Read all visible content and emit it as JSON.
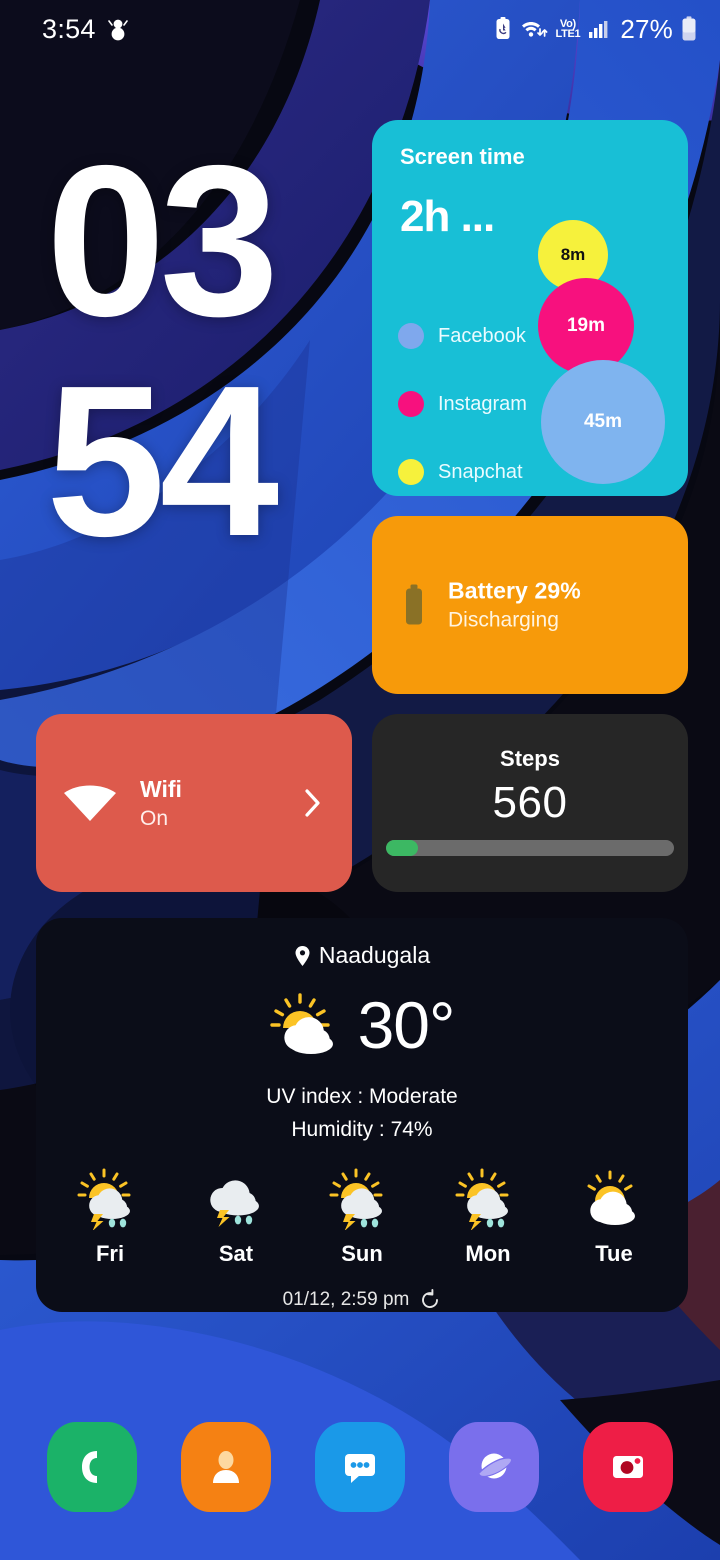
{
  "statusbar": {
    "time": "3:54",
    "notification_icon": "snowman-icon",
    "battery_saver_icon": "battery-saver-icon",
    "wifi_icon": "wifi-data-icon",
    "volte_top": "Vo)",
    "volte_bottom": "LTE1",
    "signal_icon": "signal-bars-icon",
    "battery_percent": "27%",
    "battery_icon": "battery-icon"
  },
  "clock": {
    "hours": "03",
    "minutes": "54"
  },
  "screen_time": {
    "title": "Screen time",
    "total": "2h ...",
    "legend": [
      {
        "label": "Facebook",
        "color": "#7FA8ED"
      },
      {
        "label": "Instagram",
        "color": "#F7117E"
      },
      {
        "label": "Snapchat",
        "color": "#F6F13C"
      }
    ],
    "bubbles": [
      {
        "label": "8m",
        "color": "#F6F13C",
        "text_color": "#111111"
      },
      {
        "label": "19m",
        "color": "#F7117E",
        "text_color": "#ffffff"
      },
      {
        "label": "45m",
        "color": "#7FB4EF",
        "text_color": "#ffffff"
      }
    ],
    "card_color": "#18BFD6"
  },
  "battery_widget": {
    "icon": "battery-icon",
    "title": "Battery 29%",
    "subtitle": "Discharging",
    "card_color": "#F79A0A"
  },
  "wifi_widget": {
    "icon": "wifi-icon",
    "title": "Wifi",
    "subtitle": "On",
    "chevron": "chevron-right-icon",
    "card_color": "#DD5A4C"
  },
  "steps_widget": {
    "title": "Steps",
    "value": "560",
    "progress_percent": 11,
    "bar_color": "#3CB863",
    "card_color": "#262626"
  },
  "weather": {
    "location_icon": "location-pin-icon",
    "location": "Naadugala",
    "condition_icon": "sun-behind-cloud-icon",
    "temperature": "30°",
    "uv_index": "UV index : Moderate",
    "humidity": "Humidity : 74%",
    "forecast": [
      {
        "day": "Fri",
        "icon": "sun-cloud-storm-rain-icon"
      },
      {
        "day": "Sat",
        "icon": "cloud-storm-rain-icon"
      },
      {
        "day": "Sun",
        "icon": "sun-cloud-storm-rain-icon"
      },
      {
        "day": "Mon",
        "icon": "sun-cloud-storm-rain-icon"
      },
      {
        "day": "Tue",
        "icon": "sun-behind-cloud-icon"
      }
    ],
    "updated": "01/12, 2:59 pm",
    "refresh_icon": "refresh-icon",
    "card_color": "#0B0D18"
  },
  "dock": [
    {
      "name": "Phone",
      "icon": "phone-icon",
      "color": "#1BB268"
    },
    {
      "name": "Contacts",
      "icon": "contacts-icon",
      "color": "#F58113"
    },
    {
      "name": "Messages",
      "icon": "messages-icon",
      "color": "#1A99E8"
    },
    {
      "name": "Internet",
      "icon": "internet-icon",
      "color": "#7A6FEC"
    },
    {
      "name": "Camera",
      "icon": "camera-icon",
      "color": "#EE1E46"
    }
  ]
}
